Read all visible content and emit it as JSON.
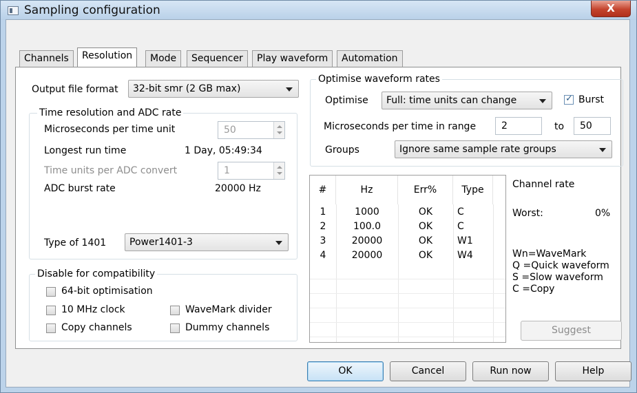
{
  "window": {
    "title": "Sampling configuration",
    "close_label": "X"
  },
  "tabs": [
    "Channels",
    "Resolution",
    "Mode",
    "Sequencer",
    "Play waveform",
    "Automation"
  ],
  "output_file": {
    "label": "Output file format",
    "value": "32-bit smr (2 GB max)"
  },
  "time_group": {
    "legend": "Time resolution and ADC rate",
    "us_per_unit_label": "Microseconds per time unit",
    "us_per_unit_value": "50",
    "longest_run_label": "Longest run time",
    "longest_run_value": "1 Day, 05:49:34",
    "units_per_adc_label": "Time units per ADC convert",
    "units_per_adc_value": "1",
    "adc_burst_label": "ADC burst rate",
    "adc_burst_value": "20000  Hz",
    "type_1401_label": "Type of 1401",
    "type_1401_value": "Power1401-3"
  },
  "compat_group": {
    "legend": "Disable for compatibility",
    "opt64": "64-bit optimisation",
    "clock10": "10 MHz clock",
    "wavemark_div": "WaveMark divider",
    "copy_ch": "Copy channels",
    "dummy_ch": "Dummy channels"
  },
  "optimise_group": {
    "legend": "Optimise waveform rates",
    "optimise_label": "Optimise",
    "optimise_value": "Full: time units can change",
    "burst_label": "Burst",
    "burst_checked": true,
    "range_label": "Microseconds per time in range",
    "range_from": "2",
    "to_label": "to",
    "range_to": "50",
    "groups_label": "Groups",
    "groups_value": "Ignore same sample rate groups"
  },
  "table": {
    "columns": [
      "#",
      "Hz",
      "Err%",
      "Type"
    ],
    "rows": [
      [
        "1",
        "1000",
        "OK",
        "C"
      ],
      [
        "2",
        "100.0",
        "OK",
        "C"
      ],
      [
        "3",
        "20000",
        "OK",
        "W1"
      ],
      [
        "4",
        "20000",
        "OK",
        "W4"
      ]
    ]
  },
  "channel_rate": {
    "heading": "Channel rate",
    "worst_label": "Worst:",
    "worst_value": "0%",
    "legend_lines": [
      "Wn=WaveMark",
      "Q =Quick waveform",
      "S =Slow waveform",
      "C =Copy"
    ],
    "suggest_label": "Suggest"
  },
  "buttons": {
    "ok": "OK",
    "cancel": "Cancel",
    "run_now": "Run now",
    "help": "Help"
  }
}
